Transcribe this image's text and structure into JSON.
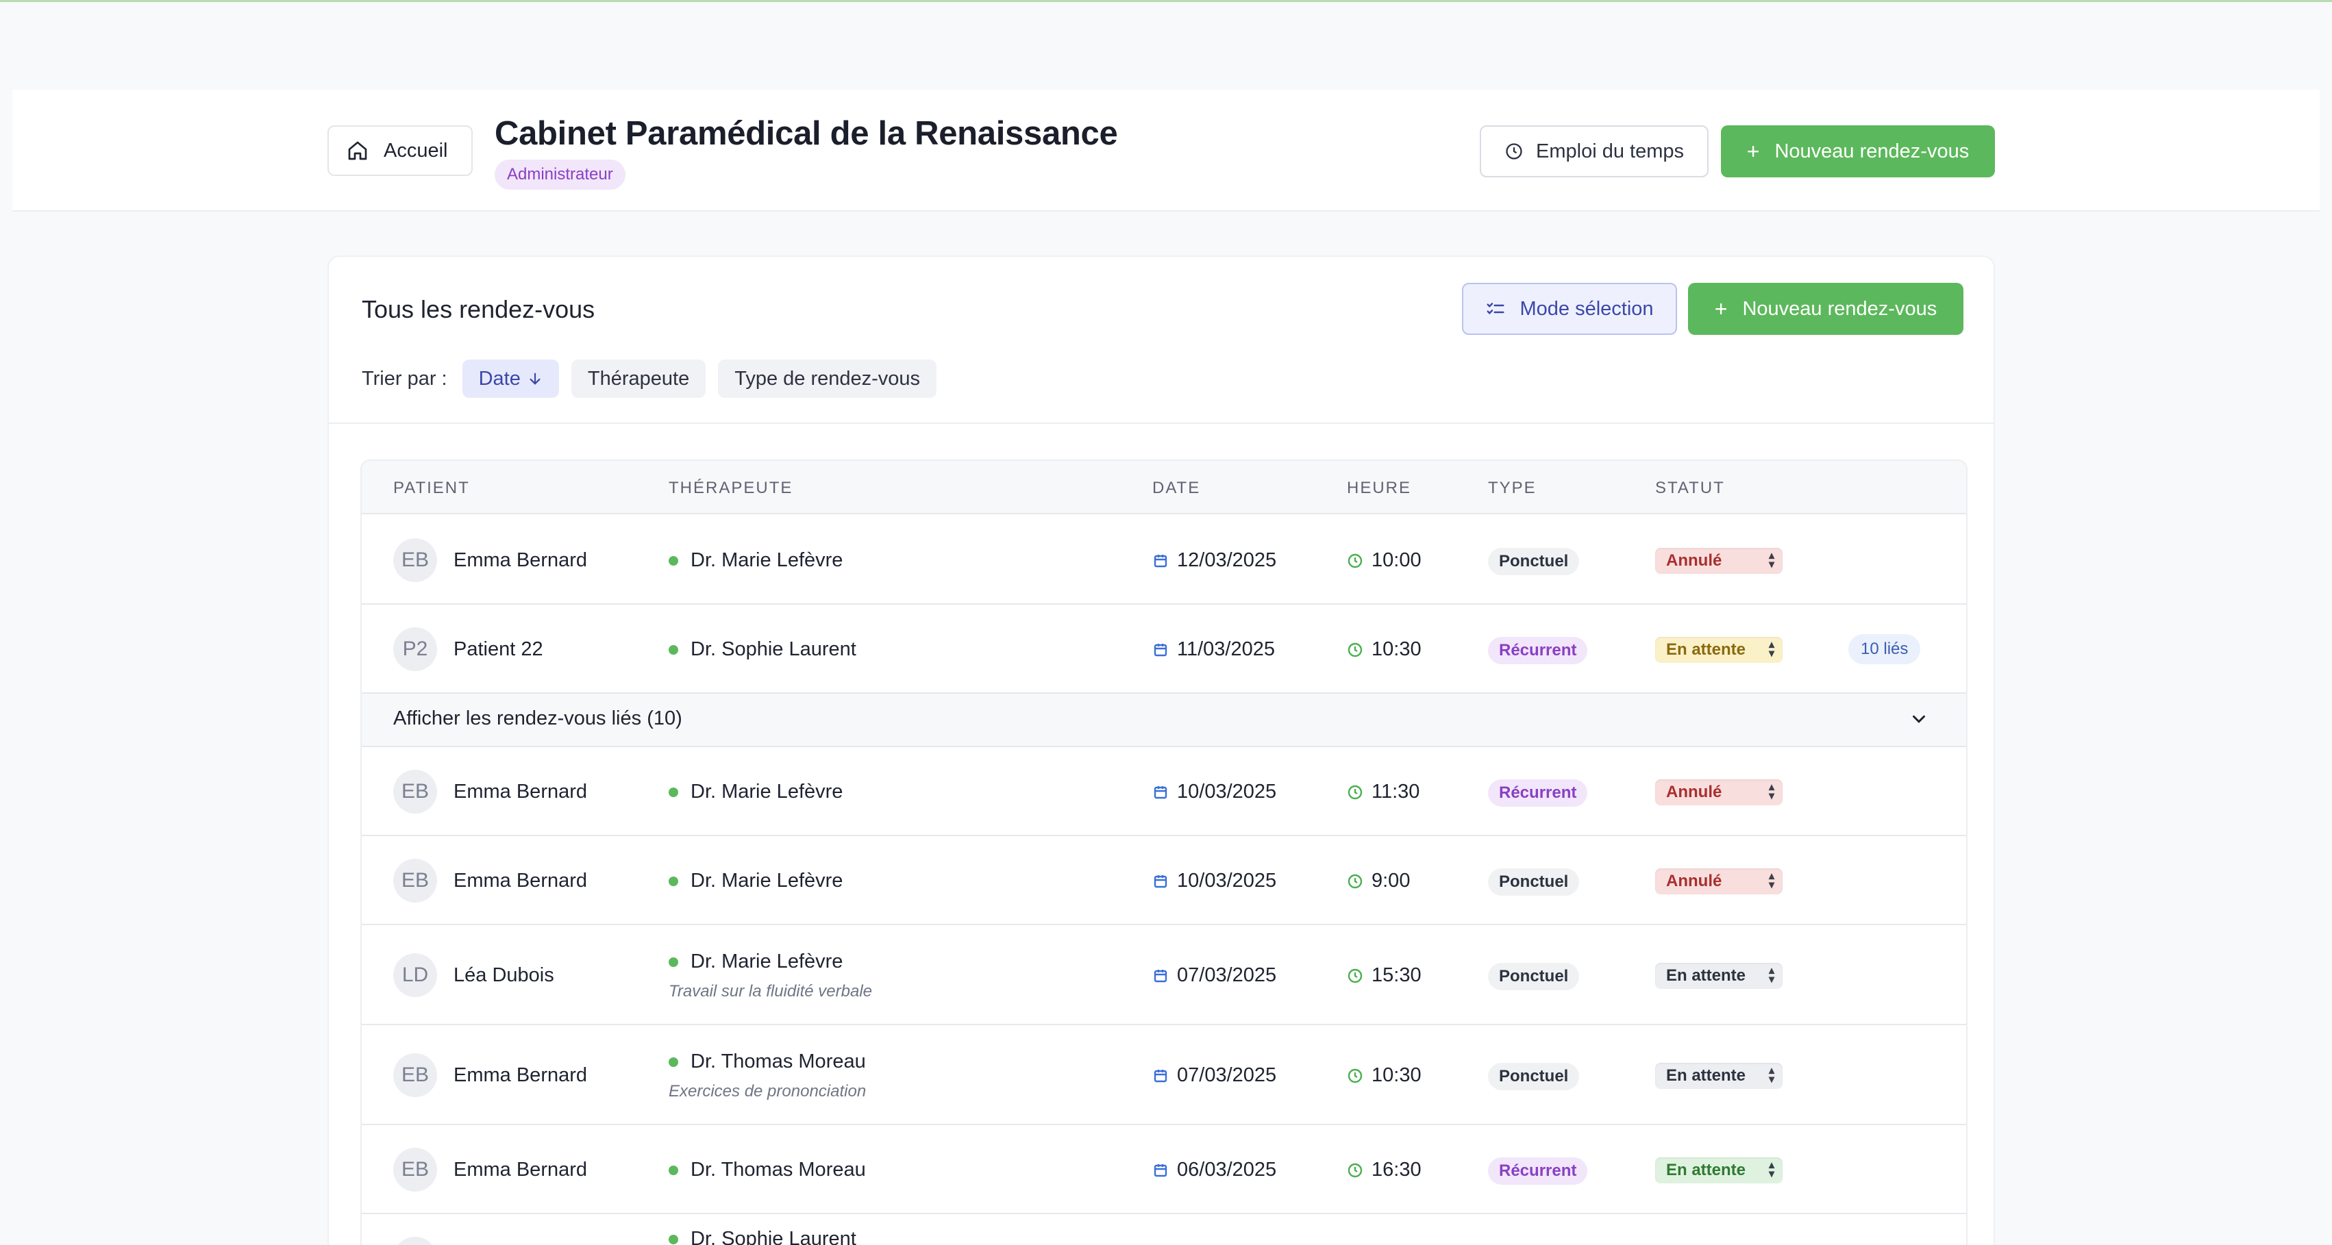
{
  "header": {
    "home_label": "Accueil",
    "title": "Cabinet Paramédical de la Renaissance",
    "role": "Administrateur",
    "schedule_label": "Emploi du temps",
    "new_label": "Nouveau rendez-vous"
  },
  "card": {
    "title": "Tous les rendez-vous",
    "select_mode_label": "Mode sélection",
    "new_label": "Nouveau rendez-vous",
    "sort_label": "Trier par :",
    "sort_options": [
      "Date",
      "Thérapeute",
      "Type de rendez-vous"
    ],
    "active_sort": "Date"
  },
  "table": {
    "columns": [
      "Patient",
      "Thérapeute",
      "Date",
      "Heure",
      "Type",
      "Statut"
    ],
    "linked_toggle_label": "Afficher les rendez-vous liés (10)",
    "rows": [
      {
        "initials": "EB",
        "patient": "Emma Bernard",
        "therapist": "Dr. Marie Lefèvre",
        "note": "",
        "date": "12/03/2025",
        "time": "10:00",
        "type": "Ponctuel",
        "status": "Annulé",
        "linked": ""
      },
      {
        "initials": "P2",
        "patient": "Patient 22",
        "therapist": "Dr. Sophie Laurent",
        "note": "",
        "date": "11/03/2025",
        "time": "10:30",
        "type": "Récurrent",
        "status": "En attente",
        "linked": "10 liés"
      },
      {
        "initials": "EB",
        "patient": "Emma Bernard",
        "therapist": "Dr. Marie Lefèvre",
        "note": "",
        "date": "10/03/2025",
        "time": "11:30",
        "type": "Récurrent",
        "status": "Annulé",
        "linked": ""
      },
      {
        "initials": "EB",
        "patient": "Emma Bernard",
        "therapist": "Dr. Marie Lefèvre",
        "note": "",
        "date": "10/03/2025",
        "time": "9:00",
        "type": "Ponctuel",
        "status": "Annulé",
        "linked": ""
      },
      {
        "initials": "LD",
        "patient": "Léa Dubois",
        "therapist": "Dr. Marie Lefèvre",
        "note": "Travail sur la fluidité verbale",
        "date": "07/03/2025",
        "time": "15:30",
        "type": "Ponctuel",
        "status": "En attente",
        "linked": ""
      },
      {
        "initials": "EB",
        "patient": "Emma Bernard",
        "therapist": "Dr. Thomas Moreau",
        "note": "Exercices de prononciation",
        "date": "07/03/2025",
        "time": "10:30",
        "type": "Ponctuel",
        "status": "En attente",
        "linked": ""
      },
      {
        "initials": "EB",
        "patient": "Emma Bernard",
        "therapist": "Dr. Thomas Moreau",
        "note": "",
        "date": "06/03/2025",
        "time": "16:30",
        "type": "Récurrent",
        "status": "En attente",
        "linked": ""
      },
      {
        "initials": "",
        "patient": "",
        "therapist": "Dr. Sophie Laurent",
        "note": "",
        "date": "",
        "time": "",
        "type": "",
        "status": "",
        "linked": ""
      }
    ]
  },
  "colors": {
    "accent_green": "#5cb85c",
    "purple_badge": "#8a3fc4",
    "selection_blue": "#3b47a8",
    "status_cancelled": "#a8302e"
  }
}
